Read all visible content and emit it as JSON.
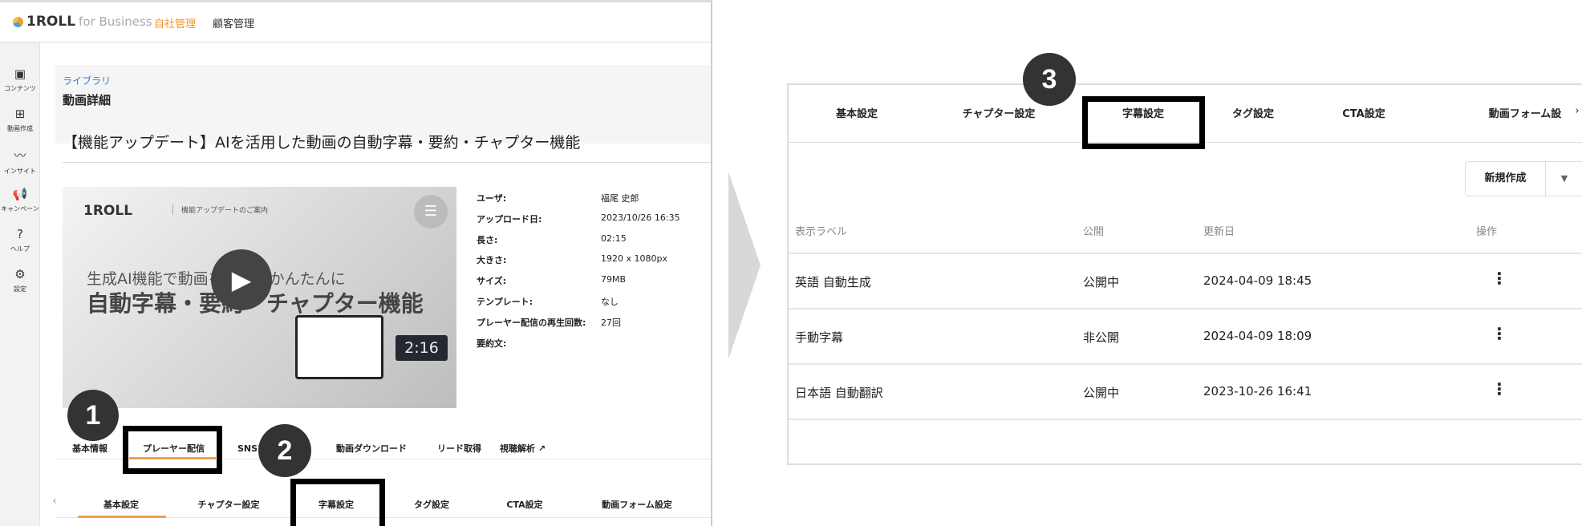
{
  "header": {
    "logo": "1ROLL",
    "logo_sub": "for Business",
    "nav": [
      "自社管理",
      "顧客管理"
    ],
    "accent": "#f0962c"
  },
  "sidebar": {
    "items": [
      {
        "icon": "content-icon",
        "label": "コンテンツ"
      },
      {
        "icon": "video-create-icon",
        "label": "動画作成"
      },
      {
        "icon": "insight-icon",
        "label": "インサイト"
      },
      {
        "icon": "megaphone-icon",
        "label": "キャンペーン"
      },
      {
        "icon": "help-icon",
        "label": "ヘルプ"
      },
      {
        "icon": "gear-icon",
        "label": "設定"
      }
    ]
  },
  "breadcrumb": {
    "parent": "ライブラリ",
    "current": "動画詳細"
  },
  "video": {
    "title": "【機能アップデート】AIを活用した動画の自動字幕・要約・チャプター機能",
    "thumb_logo": "1ROLL",
    "thumb_sub": "機能アップデートのご案内",
    "thumb_line1": "生成AI機能で動画をもっとかんたんに",
    "thumb_line2": "自動字幕・要約・チャプター機能",
    "duration": "2:16"
  },
  "meta": [
    {
      "label": "ユーザ:",
      "value": "福尾 史郎"
    },
    {
      "label": "アップロード日:",
      "value": "2023/10/26 16:35"
    },
    {
      "label": "長さ:",
      "value": "02:15"
    },
    {
      "label": "大きさ:",
      "value": "1920 x 1080px"
    },
    {
      "label": "サイズ:",
      "value": "79MB"
    },
    {
      "label": "テンプレート:",
      "value": "なし"
    },
    {
      "label": "プレーヤー配信の再生回数:",
      "value": "27回"
    },
    {
      "label": "要約文:",
      "value": ""
    }
  ],
  "main_tabs": [
    "基本情報",
    "プレーヤー配信",
    "SNSア",
    "動画ダウンロード",
    "リード取得",
    "視聴解析"
  ],
  "sub_tabs": [
    "基本設定",
    "チャプター設定",
    "字幕設定",
    "タグ設定",
    "CTA設定",
    "動画フォーム設定"
  ],
  "steps": [
    "1",
    "2",
    "3"
  ],
  "zoom_panel": {
    "tabs": [
      "基本設定",
      "チャプター設定",
      "字幕設定",
      "タグ設定",
      "CTA設定",
      "動画フォーム設"
    ],
    "new_button": "新規作成",
    "columns": [
      "表示ラベル",
      "公開",
      "更新日",
      "操作"
    ],
    "rows": [
      {
        "label": "英語 自動生成",
        "status": "公開中",
        "updated": "2024-04-09 18:45"
      },
      {
        "label": "手動字幕",
        "status": "非公開",
        "updated": "2024-04-09 18:09"
      },
      {
        "label": "日本語 自動翻訳",
        "status": "公開中",
        "updated": "2023-10-26 16:41"
      }
    ]
  }
}
